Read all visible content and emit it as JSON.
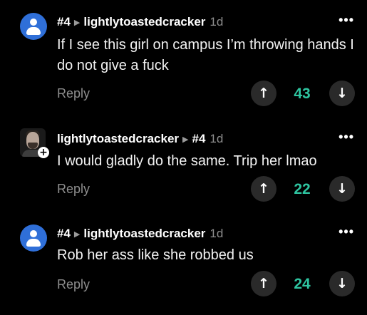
{
  "theme": {
    "background": "#000000",
    "score_color": "#2ec4a0",
    "avatar_color": "#2f6fd8"
  },
  "comments": [
    {
      "tag": "#4",
      "reply_to": "lightlytoastedcracker",
      "time": "1d",
      "text": "If I see this girl on campus I’m throwing hands I do not give a fuck",
      "reply_label": "Reply",
      "score": "43",
      "avatar": "default-user-icon",
      "more": "•••"
    },
    {
      "author": "lightlytoastedcracker",
      "reply_to": "#4",
      "time": "1d",
      "text": "I would gladly do the same. Trip her lmao",
      "reply_label": "Reply",
      "score": "22",
      "avatar": "photo",
      "more": "•••"
    },
    {
      "tag": "#4",
      "reply_to": "lightlytoastedcracker",
      "time": "1d",
      "text": "Rob her ass like she robbed us",
      "reply_label": "Reply",
      "score": "24",
      "avatar": "default-user-icon",
      "more": "•••"
    }
  ],
  "icons": {
    "upvote": "↑",
    "downvote": "↓",
    "plus": "+",
    "reply_arrow": "▶"
  }
}
